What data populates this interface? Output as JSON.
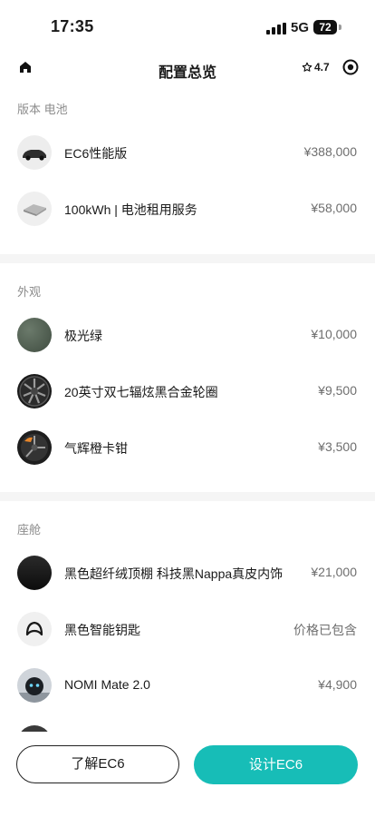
{
  "status_bar": {
    "time": "17:35",
    "network": "5G",
    "battery": "72"
  },
  "nav": {
    "title": "配置总览",
    "rating": "4.7",
    "home_icon": "home-icon",
    "star_icon": "star-icon",
    "target_icon": "target-icon"
  },
  "sections": [
    {
      "label": "版本 电池",
      "items": [
        {
          "name": "EC6性能版",
          "price": "¥388,000"
        },
        {
          "name": "100kWh | 电池租用服务",
          "price": "¥58,000"
        }
      ]
    },
    {
      "label": "外观",
      "items": [
        {
          "name": "极光绿",
          "price": "¥10,000"
        },
        {
          "name": "20英寸双七辐炫黑合金轮圈",
          "price": "¥9,500"
        },
        {
          "name": "气辉橙卡钳",
          "price": "¥3,500"
        }
      ]
    },
    {
      "label": "座舱",
      "items": [
        {
          "name": "黑色超纤绒顶棚 科技黑Nappa真皮内饰",
          "price": "¥21,000"
        },
        {
          "name": "黑色智能钥匙",
          "price": "价格已包含"
        },
        {
          "name": "NOMI Mate 2.0",
          "price": "¥4,900"
        }
      ]
    }
  ],
  "actions": {
    "learn_label": "了解EC6",
    "design_label": "设计EC6"
  },
  "colors": {
    "accent": "#17bdb7",
    "paint_green": "#4a5a4a"
  }
}
